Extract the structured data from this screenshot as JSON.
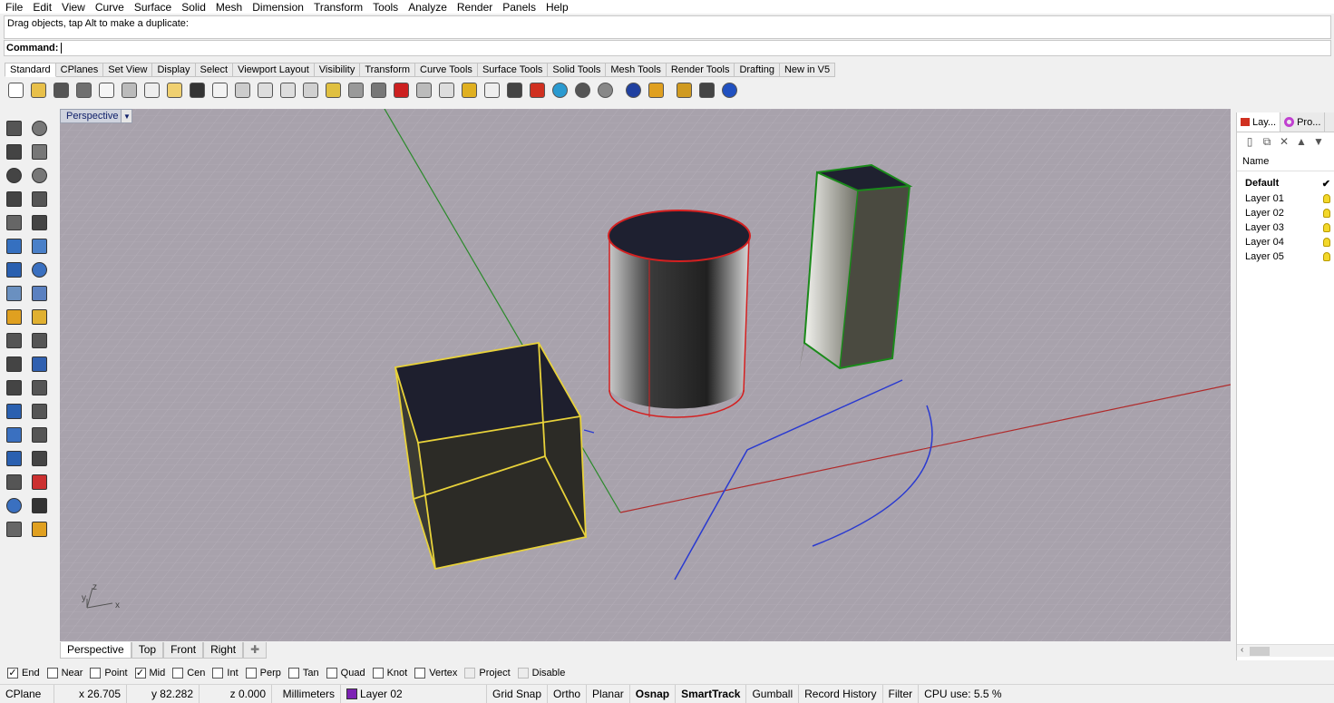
{
  "menu": [
    "File",
    "Edit",
    "View",
    "Curve",
    "Surface",
    "Solid",
    "Mesh",
    "Dimension",
    "Transform",
    "Tools",
    "Analyze",
    "Render",
    "Panels",
    "Help"
  ],
  "command": {
    "history": "Drag objects, tap Alt to make a duplicate:",
    "prompt": "Command:"
  },
  "toolbar_tabs": [
    "Standard",
    "CPlanes",
    "Set View",
    "Display",
    "Select",
    "Viewport Layout",
    "Visibility",
    "Transform",
    "Curve Tools",
    "Surface Tools",
    "Solid Tools",
    "Mesh Tools",
    "Render Tools",
    "Drafting",
    "New in V5"
  ],
  "toolbar_icons": [
    {
      "name": "new-icon",
      "color": "#ffffff"
    },
    {
      "name": "open-icon",
      "color": "#e8c04a"
    },
    {
      "name": "save-icon",
      "color": "#555555"
    },
    {
      "name": "print-icon",
      "color": "#707070"
    },
    {
      "name": "import-icon",
      "color": "#f5f5f5"
    },
    {
      "name": "cut-icon",
      "color": "#bbbbbb"
    },
    {
      "name": "copy-icon",
      "color": "#eeeeee"
    },
    {
      "name": "paste-icon",
      "color": "#f0d070"
    },
    {
      "name": "undo-icon",
      "color": "#333333"
    },
    {
      "name": "pan-icon",
      "color": "#f2f2f2"
    },
    {
      "name": "move-view-icon",
      "color": "#cccccc"
    },
    {
      "name": "zoom-dynamic-icon",
      "color": "#dddddd"
    },
    {
      "name": "zoom-window-icon",
      "color": "#dddddd"
    },
    {
      "name": "zoom-extents-icon",
      "color": "#d0d0d0"
    },
    {
      "name": "zoom-selected-icon",
      "color": "#e0c040"
    },
    {
      "name": "rotate-view-icon",
      "color": "#999999"
    },
    {
      "name": "four-viewports-icon",
      "color": "#777777"
    },
    {
      "name": "car-icon",
      "color": "#cc2020"
    },
    {
      "name": "camera-icon",
      "color": "#bbbbbb"
    },
    {
      "name": "cplane-icon",
      "color": "#dddddd"
    },
    {
      "name": "properties-icon",
      "color": "#e0b020"
    },
    {
      "name": "light-icon",
      "color": "#eeeeee"
    },
    {
      "name": "lock-icon",
      "color": "#444444"
    },
    {
      "name": "layers-icon",
      "color": "#d03020"
    },
    {
      "name": "color-wheel-icon",
      "color": "#2a9ad0"
    },
    {
      "name": "shaded-sphere-icon",
      "color": "#555555"
    },
    {
      "name": "rendered-sphere-icon",
      "color": "#888888"
    },
    {
      "name": "render-icon",
      "color": "#2040a0"
    },
    {
      "name": "brush-icon",
      "color": "#e0a020"
    },
    {
      "name": "settings-gear-icon",
      "color": "#d09a20"
    },
    {
      "name": "dimension-icon",
      "color": "#444444"
    },
    {
      "name": "help-icon",
      "color": "#2050c0"
    }
  ],
  "left_tools": [
    {
      "name": "select-icon",
      "color": "#555555"
    },
    {
      "name": "point-icon",
      "color": "#777777"
    },
    {
      "name": "polyline-icon",
      "color": "#444444"
    },
    {
      "name": "curve-icon",
      "color": "#777777"
    },
    {
      "name": "circle-icon",
      "color": "#444444"
    },
    {
      "name": "ellipse-icon",
      "color": "#777777"
    },
    {
      "name": "polygon-icon",
      "color": "#444444"
    },
    {
      "name": "rectangle-icon",
      "color": "#555555"
    },
    {
      "name": "offset-icon",
      "color": "#666666"
    },
    {
      "name": "fillet-icon",
      "color": "#444444"
    },
    {
      "name": "surface-from-curves-icon",
      "color": "#3570c0"
    },
    {
      "name": "network-surface-icon",
      "color": "#4a80c8"
    },
    {
      "name": "box-icon",
      "color": "#2a60b0"
    },
    {
      "name": "sphere-icon",
      "color": "#3a70c0"
    },
    {
      "name": "extrude-icon",
      "color": "#6a90c0"
    },
    {
      "name": "plane-surface-icon",
      "color": "#5a80c0"
    },
    {
      "name": "explode-icon",
      "color": "#e0a020"
    },
    {
      "name": "boolean-split-icon",
      "color": "#e0b030"
    },
    {
      "name": "trim-icon",
      "color": "#555555"
    },
    {
      "name": "split-icon",
      "color": "#555555"
    },
    {
      "name": "group-icon",
      "color": "#444444"
    },
    {
      "name": "array-icon",
      "color": "#3060b0"
    },
    {
      "name": "fillet-edge-icon",
      "color": "#444444"
    },
    {
      "name": "chamfer-icon",
      "color": "#555555"
    },
    {
      "name": "text-icon",
      "color": "#2a60b0"
    },
    {
      "name": "move-icon",
      "color": "#555555"
    },
    {
      "name": "snap-object-icon",
      "color": "#3a70c0"
    },
    {
      "name": "scale-icon",
      "color": "#555555"
    },
    {
      "name": "mesh-icon",
      "color": "#2a60b0"
    },
    {
      "name": "analyze-icon",
      "color": "#444444"
    },
    {
      "name": "grid-array-icon",
      "color": "#555555"
    },
    {
      "name": "dimension-tool-icon",
      "color": "#cc3030"
    },
    {
      "name": "edit-points-icon",
      "color": "#3a70c0"
    },
    {
      "name": "check-icon",
      "color": "#333333"
    },
    {
      "name": "render-mesh-icon",
      "color": "#666666"
    },
    {
      "name": "material-icon",
      "color": "#e0a020"
    }
  ],
  "viewport": {
    "name": "Perspective",
    "axis_labels": {
      "z": "z",
      "y": "y",
      "x": "x"
    }
  },
  "viewport_tabs": [
    "Perspective",
    "Top",
    "Front",
    "Right"
  ],
  "layers_panel": {
    "tabs": [
      "Lay...",
      "Pro..."
    ],
    "header": "Name",
    "default_layer": "Default",
    "current_mark": "✔",
    "layers": [
      "Layer 01",
      "Layer 02",
      "Layer 03",
      "Layer 04",
      "Layer 05"
    ]
  },
  "osnaps": [
    {
      "label": "End",
      "checked": true,
      "disabled": false
    },
    {
      "label": "Near",
      "checked": false,
      "disabled": false
    },
    {
      "label": "Point",
      "checked": false,
      "disabled": false
    },
    {
      "label": "Mid",
      "checked": true,
      "disabled": false
    },
    {
      "label": "Cen",
      "checked": false,
      "disabled": false
    },
    {
      "label": "Int",
      "checked": false,
      "disabled": false
    },
    {
      "label": "Perp",
      "checked": false,
      "disabled": false
    },
    {
      "label": "Tan",
      "checked": false,
      "disabled": false
    },
    {
      "label": "Quad",
      "checked": false,
      "disabled": false
    },
    {
      "label": "Knot",
      "checked": false,
      "disabled": false
    },
    {
      "label": "Vertex",
      "checked": false,
      "disabled": false
    },
    {
      "label": "Project",
      "checked": false,
      "disabled": true
    },
    {
      "label": "Disable",
      "checked": false,
      "disabled": true
    }
  ],
  "status": {
    "cplane": "CPlane",
    "x": "x 26.705",
    "y": "y 82.282",
    "z": "z 0.000",
    "units": "Millimeters",
    "layer": "Layer 02",
    "layer_color": "#7d22b5",
    "toggles": [
      "Grid Snap",
      "Ortho",
      "Planar",
      "Osnap",
      "SmartTrack",
      "Gumball",
      "Record History",
      "Filter"
    ],
    "bold_toggles": [
      "Osnap",
      "SmartTrack"
    ],
    "cpu": "CPU use: 5.5 %"
  }
}
